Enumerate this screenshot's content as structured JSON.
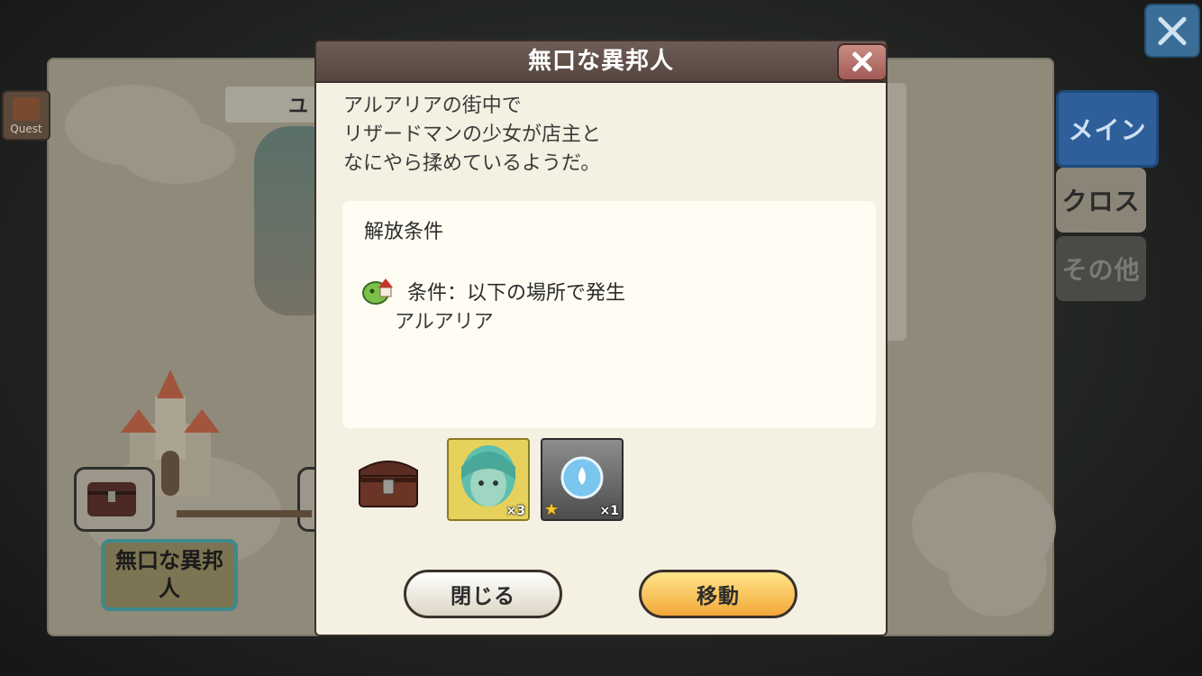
{
  "background": {
    "quest_label": "Quest",
    "banner_text": "ユ",
    "side_tabs": [
      {
        "label": "メイン",
        "active": true
      },
      {
        "label": "クロス",
        "active": false
      },
      {
        "label": "その他",
        "active": false
      }
    ],
    "map_node_label": "無口な異邦人"
  },
  "dialog": {
    "title": "無口な異邦人",
    "description": [
      "アルアリアの街中で",
      "リザードマンの少女が店主と",
      "なにやら揉めているようだ。"
    ],
    "conditions": {
      "heading": "解放条件",
      "condition_label": "条件：以下の場所で発生",
      "location": "アルアリア"
    },
    "rewards": [
      {
        "icon": "character-portrait-icon",
        "count": "×3"
      },
      {
        "icon": "water-orb-icon",
        "count": "×1",
        "star": "★"
      }
    ],
    "buttons": {
      "close": "閉じる",
      "move": "移動"
    }
  },
  "colors": {
    "dialog_bg": "#f4f0e2",
    "title_bar": "#5e4d46",
    "move_button": "#f7c25a",
    "active_tab": "#2e5f9a"
  }
}
